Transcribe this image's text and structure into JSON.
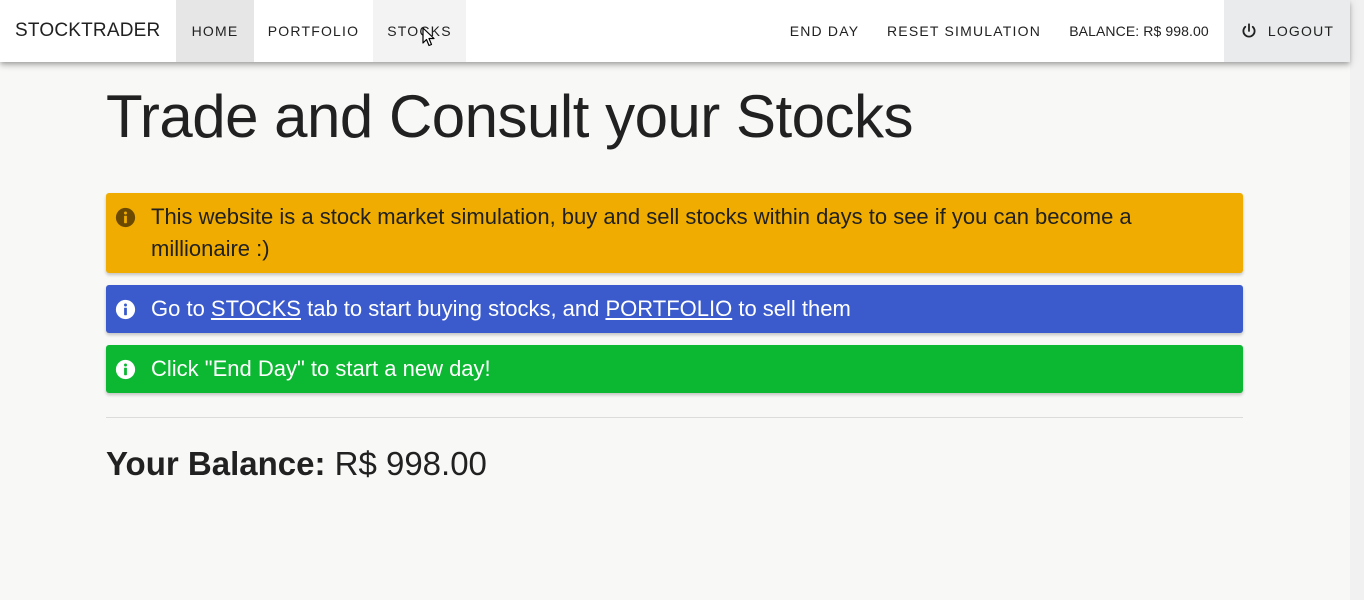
{
  "app": {
    "brand": "STOCKTRADER"
  },
  "nav": {
    "home": "Home",
    "portfolio": "Portfolio",
    "stocks": "Stocks",
    "end_day": "End Day",
    "reset": "Reset Simulation",
    "balance": "BALANCE: R$ 998.00",
    "logout": "Logout"
  },
  "main": {
    "title": "Trade and Consult your Stocks",
    "alert_warning": "This website is a stock market simulation, buy and sell stocks within days to see if you can become a millionaire :)",
    "alert_info": {
      "prefix": "Go to ",
      "link_stocks": "STOCKS",
      "middle": " tab to start buying stocks, and ",
      "link_portfolio": "PORTFOLIO",
      "suffix": " to sell them"
    },
    "alert_success": "Click \"End Day\" to start a new day!",
    "balance_label": "Your Balance:",
    "balance_value": "R$ 998.00"
  },
  "colors": {
    "warning": "#f0ac00",
    "info": "#3b5bcc",
    "success": "#0cb832",
    "active_tab": "#e6e6e6"
  },
  "icons": {
    "alert_icon": "info-circle-icon",
    "logout_icon": "power-icon"
  }
}
